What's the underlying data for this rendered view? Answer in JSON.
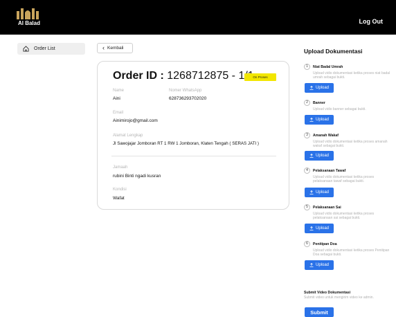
{
  "header": {
    "logo_text": "Al Balad",
    "logout_label": "Log Out"
  },
  "sidebar": {
    "items": [
      {
        "label": "Order List",
        "icon": "home-icon"
      }
    ]
  },
  "back_label": "Kembali",
  "order": {
    "id_label": "Order ID :",
    "id_value": "1268712875 - 1/1",
    "status": "On Proses",
    "fields": {
      "name_label": "Name",
      "name_value": "Aini",
      "whatsapp_label": "Nomer WhatsApp",
      "whatsapp_value": "628736293702020",
      "email_label": "Email",
      "email_value": "Ainimirojo@gmail.com",
      "address_label": "Alamat Lengkap",
      "address_value": "Jl Sawojajar Jomboran RT 1 RW 1 Jomboran, Klaten Tengah ( SERAS JATI )",
      "jamaah_label": "Jamaah",
      "jamaah_value": "rubini Binti ngadi kusran",
      "kondisi_label": "Kondisi",
      "kondisi_value": "Wafat"
    }
  },
  "upload": {
    "title": "Upload Dokumentasi",
    "button_label": "Upload",
    "steps": [
      {
        "num": "1",
        "title": "Niat Badal Umrah",
        "desc": "Upload vidio dokumentasi ketika proses niat badal umrah sebagai bukti."
      },
      {
        "num": "2",
        "title": "Banner",
        "desc": "Upload vidio banner sebagai bukti."
      },
      {
        "num": "3",
        "title": "Amanah Wakaf",
        "desc": "Upload vidio dokumentasi ketika proses amanah wakaf sebagai bukti."
      },
      {
        "num": "4",
        "title": "Pelaksanaan Tawaf",
        "desc": "Upload vidio dokumentasi ketika proses pelaksanaan tawaf sebagai bukti."
      },
      {
        "num": "5",
        "title": "Pelaksanaan Sai",
        "desc": "Upload vidio dokumentasi ketika proses pelaksanaan sai sebagai bukti."
      },
      {
        "num": "6",
        "title": "Penitipan Doa",
        "desc": "Upload vidio dokumentasi ketika proses Penitipan Doa sebagai bukti."
      }
    ]
  },
  "submit": {
    "title": "Submit Video Dokumentasi",
    "desc": "Submit video untuk mengirim video ke admin.",
    "button_label": "Submit"
  },
  "colors": {
    "topbar": "#000000",
    "accent": "#2a72e8",
    "badge": "#f2e600"
  }
}
